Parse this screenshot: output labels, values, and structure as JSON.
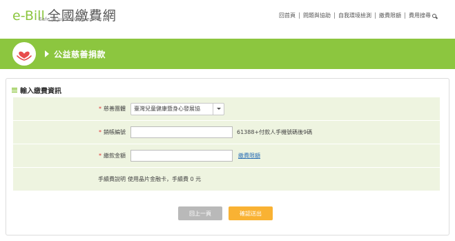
{
  "header": {
    "logo_eb": "e-Bill",
    "logo_title": "全國繳費網",
    "logo_tagline": "Safe | Quick | Convenient",
    "nav": [
      "回首頁",
      "問題與協助",
      "自我環境檢測",
      "繳費限額",
      "費用搜尋"
    ]
  },
  "banner": {
    "title": "公益慈善捐款"
  },
  "form": {
    "section_title": "輸入繳費資訊",
    "charity_label": "慈善團體",
    "charity_value": "臺灣兒童健康暨身心發展協",
    "account_label": "銷帳編號",
    "account_value": "",
    "account_hint": "61388+付款人手機號碼後9碼",
    "amount_label": "繳款金額",
    "amount_value": "",
    "amount_link": "繳費限額",
    "fee_label": "手續費說明",
    "fee_text": "使用晶片金融卡，手續費 0 元",
    "back_button": "回上一頁",
    "confirm_button": "確認送出"
  },
  "colors": {
    "brand_green": "#8cc63f",
    "form_bg": "#eef4e0",
    "confirm": "#f9b233",
    "back": "#b9b9b9",
    "heart": "#e84c4c"
  }
}
